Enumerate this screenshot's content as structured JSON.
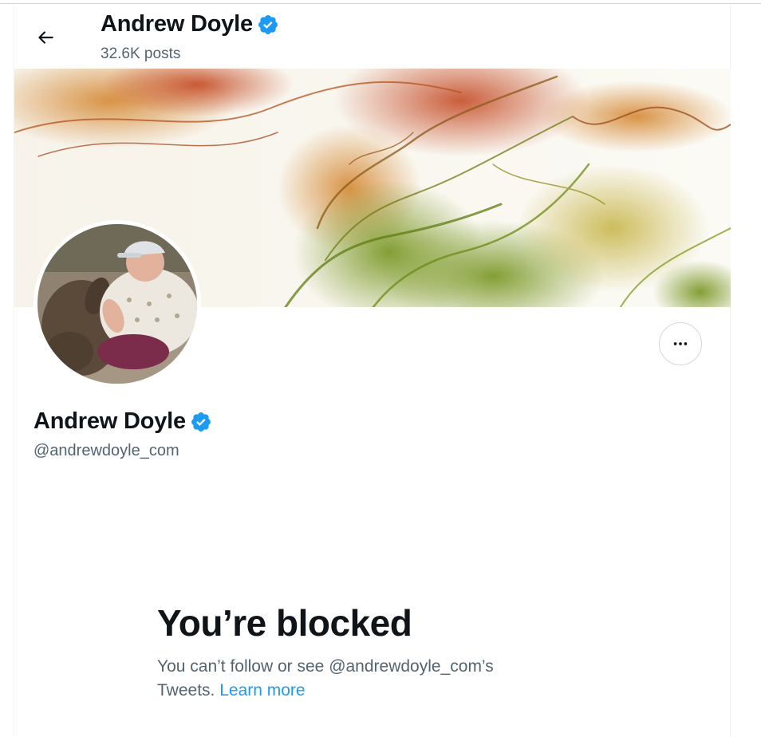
{
  "header": {
    "name": "Andrew Doyle",
    "posts": "32.6K posts"
  },
  "profile": {
    "name": "Andrew Doyle",
    "handle": "@andrewdoyle_com",
    "verified": true
  },
  "blocked": {
    "title": "You’re blocked",
    "message": "You can’t follow or see @andrewdoyle_com’s Tweets.",
    "link": "Learn more"
  },
  "icons": {
    "back": "arrow-left-icon",
    "verified": "verified-badge-icon",
    "more": "more-horizontal-icon"
  },
  "colors": {
    "text_primary": "#0f1419",
    "text_secondary": "#536471",
    "accent": "#1d9bf0",
    "verified": "#1d9bf0"
  }
}
